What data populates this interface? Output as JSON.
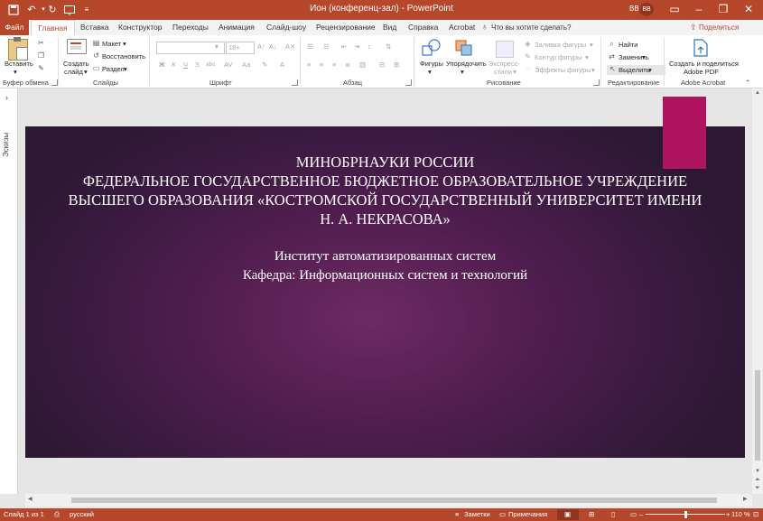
{
  "app": {
    "title": "Ион (конференц-зал)  -  PowerPoint",
    "user_initials": "ВВ",
    "user_badge": "ВВ",
    "brand_color": "#b7472a"
  },
  "quick_access": {
    "save_icon": "save-icon",
    "undo_icon": "undo-icon",
    "redo_icon": "redo-icon",
    "start_icon": "start-presentation-icon",
    "more_glyph": "▾"
  },
  "tabs": [
    {
      "label": "Файл"
    },
    {
      "label": "Главная"
    },
    {
      "label": "Вставка"
    },
    {
      "label": "Конструктор"
    },
    {
      "label": "Переходы"
    },
    {
      "label": "Анимация"
    },
    {
      "label": "Слайд-шоу"
    },
    {
      "label": "Рецензирование"
    },
    {
      "label": "Вид"
    },
    {
      "label": "Справка"
    },
    {
      "label": "Acrobat"
    }
  ],
  "tellme": "Что вы хотите сделать?",
  "share": "Поделиться",
  "ribbon": {
    "clipboard": {
      "label": "Буфер обмена",
      "paste": "Вставить"
    },
    "slides": {
      "label": "Слайды",
      "new_slide_line1": "Создать",
      "new_slide_line2": "слайд",
      "layout": "Макет",
      "reset": "Восстановить",
      "section": "Раздел"
    },
    "font": {
      "label": "Шрифт",
      "size": "18+",
      "bold": "Ж",
      "italic": "К",
      "underline": "Ч",
      "strike": "S",
      "shadow": "abc",
      "case": "Аа"
    },
    "paragraph": {
      "label": "Абзац"
    },
    "drawing": {
      "label": "Рисование",
      "shapes": "Фигуры",
      "arrange": "Упорядочить",
      "quick_styles_line1": "Экспресс-",
      "quick_styles_line2": "стили",
      "fill": "Заливка фигуры",
      "outline": "Контур фигуры",
      "effects": "Эффекты фигуры"
    },
    "editing": {
      "label": "Редактирование",
      "find": "Найти",
      "replace": "Заменить",
      "select": "Выделить"
    },
    "acrobat": {
      "label": "Adobe Acrobat",
      "create_line1": "Создать и поделиться",
      "create_line2": "Adobe PDF"
    }
  },
  "thumbnail_pane": {
    "label": "Эскизы"
  },
  "slide": {
    "accent_color": "#ae1460",
    "lines": [
      "МИНОБРНАУКИ РОССИИ",
      "ФЕДЕРАЛЬНОЕ ГОСУДАРСТВЕННОЕ БЮДЖЕТНОЕ ОБРАЗОВАТЕЛЬНОЕ УЧРЕЖДЕНИЕ",
      "ВЫСШЕГО ОБРАЗОВАНИЯ «КОСТРОМСКОЙ ГОСУДАРСТВЕННЫЙ УНИВЕРСИТЕТ ИМЕНИ",
      "Н. А. НЕКРАСОВА»",
      "Институт автоматизированных систем",
      "Кафедра: Информационных систем и технологий"
    ]
  },
  "status": {
    "slide_counter": "Слайд 1 из 1",
    "language": "русский",
    "notes": "Заметки",
    "comments": "Примечания",
    "zoom": "110 %",
    "zoom_level": 0.5
  }
}
